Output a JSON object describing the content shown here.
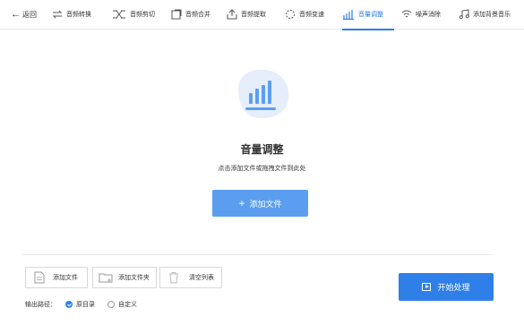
{
  "toolbar": {
    "back_label": "返回",
    "tabs": [
      {
        "label": "音频转换",
        "icon": "convert-arrows-icon"
      },
      {
        "label": "音频剪切",
        "icon": "scissors-icon"
      },
      {
        "label": "音频合并",
        "icon": "merge-icon"
      },
      {
        "label": "音频提取",
        "icon": "extract-icon"
      },
      {
        "label": "音频变速",
        "icon": "speed-icon"
      },
      {
        "label": "音量调整",
        "icon": "volume-bars-icon",
        "active": true
      },
      {
        "label": "噪声消除",
        "icon": "denoise-icon"
      },
      {
        "label": "添加背景音乐",
        "icon": "music-note-icon"
      }
    ]
  },
  "main": {
    "title": "音量调整",
    "hint": "点击添加文件或拖拽文件到此处",
    "add_file_button": "添加文件"
  },
  "bottom": {
    "add_file": "添加文件",
    "add_folder": "添加文件夹",
    "clear_list": "清空列表",
    "output_label": "输出路径：",
    "option_original": "原目录",
    "option_custom": "自定义",
    "start_button": "开始处理"
  },
  "colors": {
    "accent": "#2f7fe8",
    "add_button": "#5b9ef0",
    "hero_blob": "#e6eefb"
  }
}
